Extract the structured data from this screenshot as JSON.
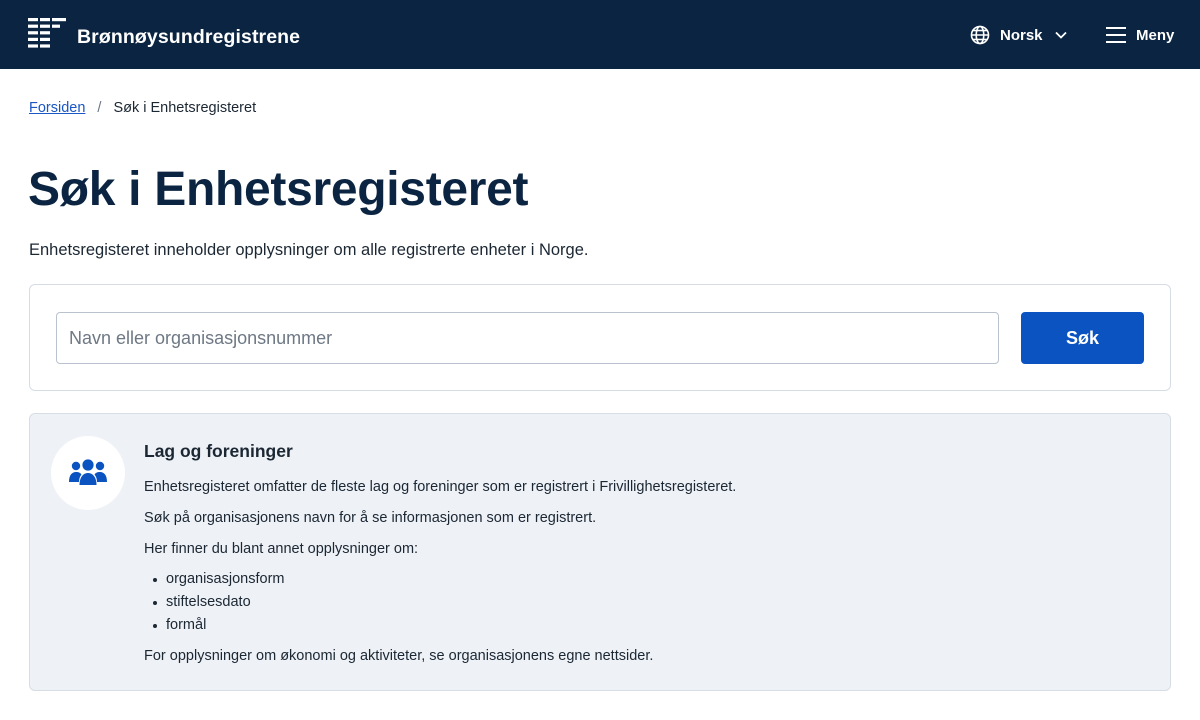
{
  "header": {
    "brand_name": "Brønnøysundregistrene",
    "language_label": "Norsk",
    "menu_label": "Meny"
  },
  "breadcrumb": {
    "home_label": "Forsiden",
    "separator": "/",
    "current_label": "Søk i Enhetsregisteret"
  },
  "page": {
    "title": "Søk i Enhetsregisteret",
    "lead": "Enhetsregisteret inneholder opplysninger om alle registrerte enheter i Norge."
  },
  "search": {
    "placeholder": "Navn eller organisasjonsnummer",
    "value": "",
    "button_label": "Søk"
  },
  "info": {
    "icon": "users-icon",
    "title": "Lag og foreninger",
    "paragraphs": [
      "Enhetsregisteret omfatter de fleste lag og foreninger som er registrert i Frivillighetsregisteret.",
      "Søk på organisasjonens navn for å se informasjonen som er registrert.",
      "Her finner du blant annet opplysninger om:"
    ],
    "list": [
      "organisasjonsform",
      "stiftelsesdato",
      "formål"
    ],
    "footer": "For opplysninger om økonomi og aktiviteter, se organisasjonens egne nettsider."
  },
  "colors": {
    "header_bg": "#0b2441",
    "primary": "#0b53c0",
    "link": "#1a56c4",
    "panel_bg": "#eef1f6"
  }
}
